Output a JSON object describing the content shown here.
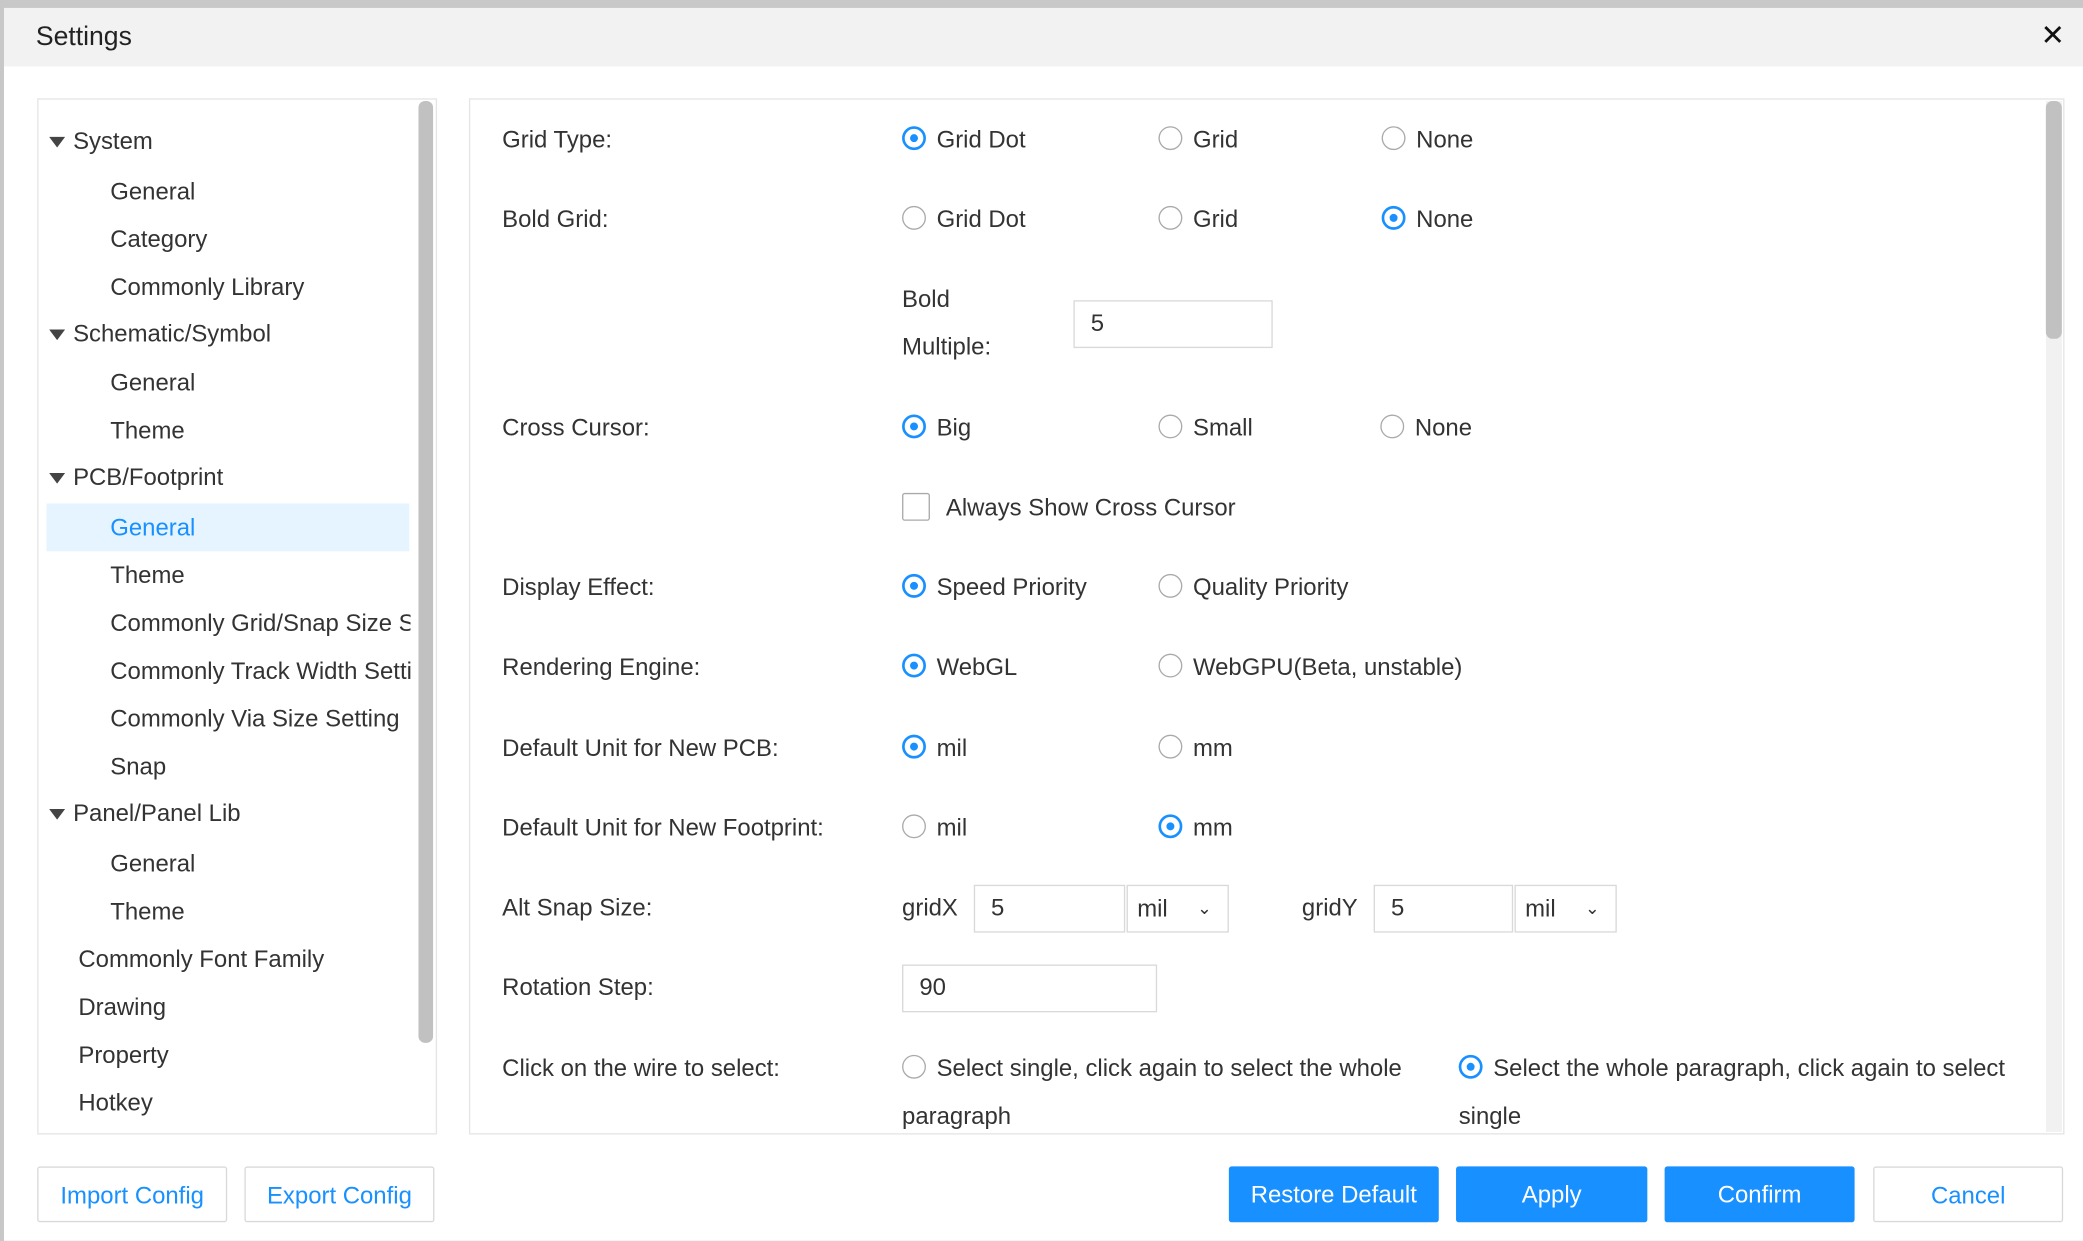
{
  "dialog": {
    "title": "Settings",
    "close_icon": "close-icon"
  },
  "sidebar": {
    "items": [
      {
        "label": "System",
        "level": 0,
        "expanded": true
      },
      {
        "label": "General",
        "level": 1
      },
      {
        "label": "Category",
        "level": 1
      },
      {
        "label": "Commonly Library",
        "level": 1
      },
      {
        "label": "Schematic/Symbol",
        "level": 0,
        "expanded": true
      },
      {
        "label": "General",
        "level": 1
      },
      {
        "label": "Theme",
        "level": 1
      },
      {
        "label": "PCB/Footprint",
        "level": 0,
        "expanded": true
      },
      {
        "label": "General",
        "level": 1,
        "selected": true
      },
      {
        "label": "Theme",
        "level": 1
      },
      {
        "label": "Commonly Grid/Snap Size S",
        "level": 1
      },
      {
        "label": "Commonly Track Width Setti",
        "level": 1
      },
      {
        "label": "Commonly Via Size Setting",
        "level": 1
      },
      {
        "label": "Snap",
        "level": 1
      },
      {
        "label": "Panel/Panel Lib",
        "level": 0,
        "expanded": true
      },
      {
        "label": "General",
        "level": 1
      },
      {
        "label": "Theme",
        "level": 1
      },
      {
        "label": "Commonly Font Family",
        "level": 0
      },
      {
        "label": "Drawing",
        "level": 0
      },
      {
        "label": "Property",
        "level": 0
      },
      {
        "label": "Hotkey",
        "level": 0
      }
    ]
  },
  "settings": {
    "grid_type": {
      "label": "Grid Type:",
      "options": [
        "Grid Dot",
        "Grid",
        "None"
      ],
      "selected": "Grid Dot"
    },
    "bold_grid": {
      "label": "Bold Grid:",
      "options": [
        "Grid Dot",
        "Grid",
        "None"
      ],
      "selected": "None"
    },
    "bold_multiple": {
      "label1": "Bold",
      "label2": "Multiple:",
      "value": "5"
    },
    "cross_cursor": {
      "label": "Cross Cursor:",
      "options": [
        "Big",
        "Small",
        "None"
      ],
      "selected": "Big"
    },
    "always_show": {
      "label": "Always Show Cross Cursor",
      "checked": false
    },
    "display_effect": {
      "label": "Display Effect:",
      "options": [
        "Speed Priority",
        "Quality Priority"
      ],
      "selected": "Speed Priority"
    },
    "rendering_engine": {
      "label": "Rendering Engine:",
      "options": [
        "WebGL",
        "WebGPU(Beta, unstable)"
      ],
      "selected": "WebGL"
    },
    "unit_pcb": {
      "label": "Default Unit for New PCB:",
      "options": [
        "mil",
        "mm"
      ],
      "selected": "mil"
    },
    "unit_footprint": {
      "label": "Default Unit for New Footprint:",
      "options": [
        "mil",
        "mm"
      ],
      "selected": "mm"
    },
    "alt_snap": {
      "label": "Alt Snap Size:",
      "gridx_label": "gridX",
      "gridx": "5",
      "gridx_unit": "mil",
      "gridy_label": "gridY",
      "gridy": "5",
      "gridy_unit": "mil"
    },
    "rotation_step": {
      "label": "Rotation Step:",
      "value": "90"
    },
    "wire_select": {
      "label": "Click on the wire to select:",
      "opt1_line1": "Select single, click again to select the whole",
      "opt1_line2": "paragraph",
      "opt2_line1": "Select the whole paragraph, click again to select",
      "opt2_line2": "single",
      "selected": 2
    }
  },
  "footer": {
    "import": "Import Config",
    "export": "Export Config",
    "restore": "Restore Default",
    "apply": "Apply",
    "confirm": "Confirm",
    "cancel": "Cancel"
  },
  "colors": {
    "accent": "#1890ff",
    "selected_bg": "#e6f4ff"
  }
}
